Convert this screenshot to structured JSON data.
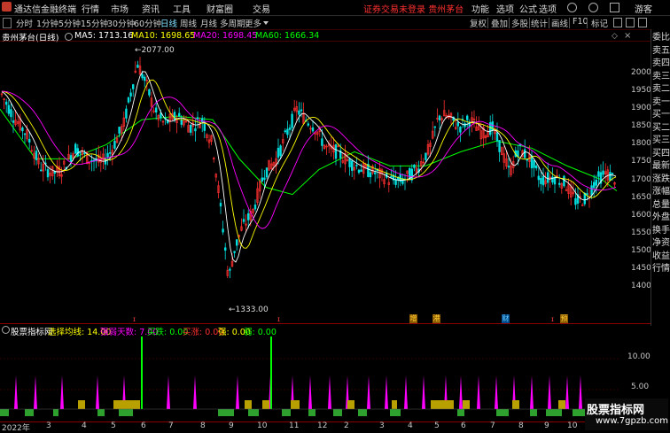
{
  "titlebar": {
    "app_name": "通达信金融终端",
    "menus": [
      "行情",
      "市场",
      "资讯",
      "工具",
      "财富圈",
      "交易"
    ],
    "login_status": "证券交易未登录",
    "stock_short": "贵州茅台",
    "right_menus": [
      "功能",
      "选项",
      "公式",
      "选项"
    ],
    "guest": "游客"
  },
  "toolbar": {
    "periods": [
      "分时",
      "1分钟",
      "5分钟",
      "15分钟",
      "30分钟",
      "60分钟",
      "日线",
      "周线",
      "月线",
      "多周期",
      "更多"
    ],
    "active_period": "日线",
    "tools": [
      "复权",
      "叠加",
      "多股",
      "统计",
      "画线",
      "F10",
      "标记"
    ]
  },
  "chart": {
    "stock_title": "贵州茅台(日线)",
    "ma": [
      {
        "label": "MA5: 1713.16",
        "color": "#ffffff"
      },
      {
        "label": "MA10: 1698.65",
        "color": "#ffff00"
      },
      {
        "label": "MA20: 1698.45",
        "color": "#ff00ff"
      },
      {
        "label": "MA60: 1666.34",
        "color": "#00ff00"
      }
    ],
    "high_label": "2077.00",
    "low_label": "1333.00",
    "yticks": [
      "2000",
      "1950",
      "1900",
      "1850",
      "1800",
      "1750",
      "1700",
      "1650",
      "1600",
      "1550",
      "1500",
      "1450",
      "1400"
    ],
    "xticks": [
      "2022年",
      "3",
      "4",
      "5",
      "6",
      "7",
      "8",
      "9",
      "10",
      "11",
      "12",
      "2",
      "3",
      "4",
      "5",
      "6",
      "7",
      "8",
      "9",
      "10",
      "11",
      "12"
    ],
    "event_markers": [
      "增",
      "港",
      "财",
      "预"
    ]
  },
  "right_panel": [
    "委比",
    "卖五",
    "卖四",
    "卖三",
    "卖二",
    "卖一",
    "买一",
    "买二",
    "买三",
    "买四",
    "最新",
    "涨跌",
    "涨幅",
    "总量",
    "外盘",
    "换手",
    "净资",
    "收益",
    "行情"
  ],
  "indicator": {
    "name": "股票指标网",
    "params": [
      {
        "label": "选择均线: 14.00",
        "color": "#ffff00"
      },
      {
        "label": "强弱天数: 7.00",
        "color": "#ff00ff"
      },
      {
        "label": "买跌: 0.00",
        "color": "#00ff00"
      },
      {
        "label": "买涨: 0.00",
        "color": "#ff3030"
      },
      {
        "label": "强: 0.00",
        "color": "#ffff00"
      },
      {
        "label": "弱: 0.00",
        "color": "#00ff00"
      }
    ],
    "yticks": [
      "10.00",
      "5.00"
    ]
  },
  "watermark": {
    "title": "股票指标网",
    "url": "www.7gpzb.com"
  },
  "colors": {
    "up": "#ff3030",
    "down": "#00e0e0",
    "ma5": "#ffffff",
    "ma10": "#ffff00",
    "ma20": "#ff00ff",
    "ma60": "#00ff00"
  }
}
